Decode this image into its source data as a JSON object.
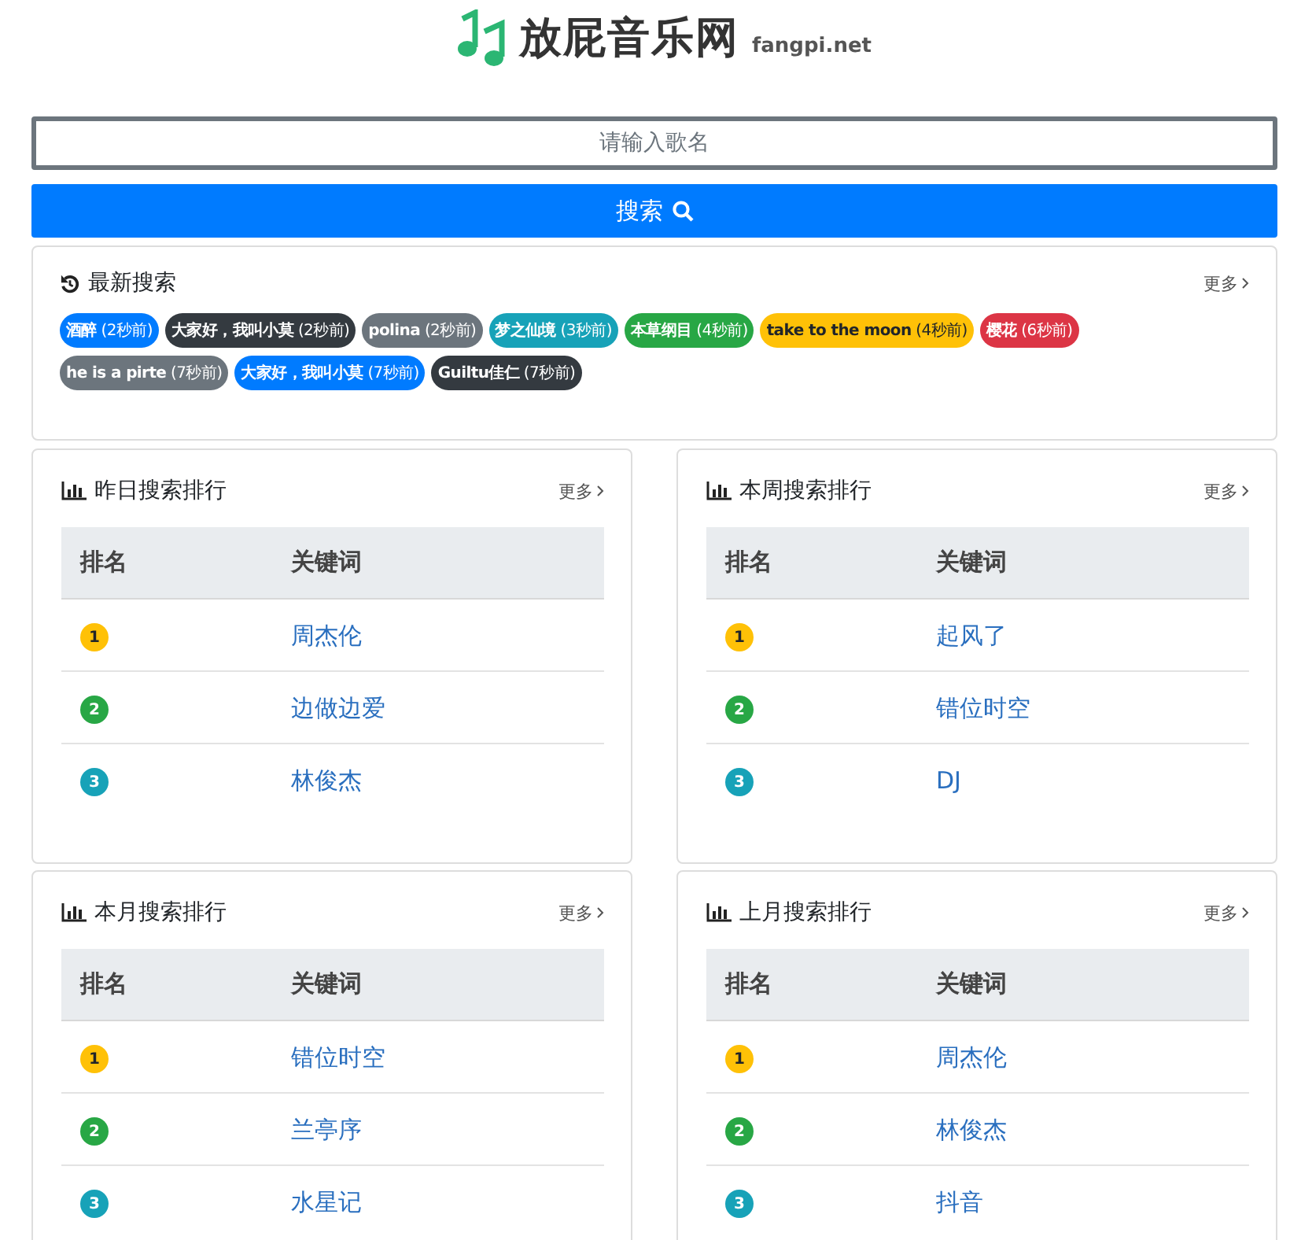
{
  "header": {
    "site_name": "放屁音乐网",
    "domain": "fangpi.net"
  },
  "search": {
    "placeholder": "请输入歌名",
    "button": "搜索"
  },
  "recent": {
    "title": "最新搜索",
    "more": "更多",
    "tags": [
      {
        "text": "**酒醉** (2秒前)",
        "color": "#007bff"
      },
      {
        "text": "**大家好，我叫小莫** (2秒前)",
        "color": "#343a40"
      },
      {
        "text": "**polina** (2秒前)",
        "color": "#6c757d"
      },
      {
        "text": "**梦之仙境** (3秒前)",
        "color": "#17a2b8"
      },
      {
        "text": "**本草纲目** (4秒前)",
        "color": "#28a745"
      },
      {
        "text": "**take to the moon** (4秒前)",
        "color": "#ffc107"
      },
      {
        "text": "**樱花** (6秒前)",
        "color": "#dc3545"
      },
      {
        "text": "**he is a pirte** (7秒前)",
        "color": "#6c757d"
      },
      {
        "text": "**大家好，我叫小莫** (7秒前)",
        "color": "#007bff"
      },
      {
        "text": "**Guiltu佳仁** (7秒前)",
        "color": "#343a40"
      }
    ]
  },
  "rankings": [
    {
      "title": "昨日搜索排行",
      "more": "更多",
      "columns": [
        "排名",
        "关键词"
      ],
      "rows": [
        {
          "rank": "1",
          "color": "#ffc107",
          "keyword": "周杰伦"
        },
        {
          "rank": "2",
          "color": "#28a745",
          "keyword": "边做边爱"
        },
        {
          "rank": "3",
          "color": "#17a2b8",
          "keyword": "林俊杰"
        }
      ]
    },
    {
      "title": "本周搜索排行",
      "more": "更多",
      "columns": [
        "排名",
        "关键词"
      ],
      "rows": [
        {
          "rank": "1",
          "color": "#ffc107",
          "keyword": "起风了"
        },
        {
          "rank": "2",
          "color": "#28a745",
          "keyword": "错位时空"
        },
        {
          "rank": "3",
          "color": "#17a2b8",
          "keyword": "DJ"
        }
      ]
    },
    {
      "title": "本月搜索排行",
      "more": "更多",
      "columns": [
        "排名",
        "关键词"
      ],
      "rows": [
        {
          "rank": "1",
          "color": "#ffc107",
          "keyword": "错位时空"
        },
        {
          "rank": "2",
          "color": "#28a745",
          "keyword": "兰亭序"
        },
        {
          "rank": "3",
          "color": "#17a2b8",
          "keyword": "水星记"
        }
      ]
    },
    {
      "title": "上月搜索排行",
      "more": "更多",
      "columns": [
        "排名",
        "关键词"
      ],
      "rows": [
        {
          "rank": "1",
          "color": "#ffc107",
          "keyword": "周杰伦"
        },
        {
          "rank": "2",
          "color": "#28a745",
          "keyword": "林俊杰"
        },
        {
          "rank": "3",
          "color": "#17a2b8",
          "keyword": "抖音"
        }
      ]
    }
  ]
}
